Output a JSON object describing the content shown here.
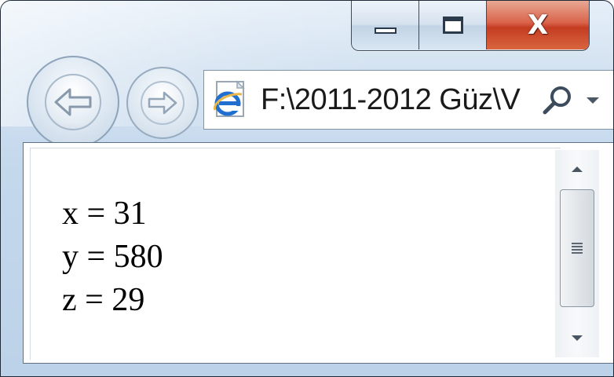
{
  "window": {
    "caption": {
      "minimize_icon": "minimize-icon",
      "maximize_icon": "maximize-icon",
      "close_glyph": "X"
    }
  },
  "navigation": {
    "back_icon": "back-arrow-icon",
    "forward_icon": "forward-arrow-icon"
  },
  "address_bar": {
    "url": "F:\\2011-2012 Güz\\V",
    "browser_icon": "internet-explorer-icon",
    "search_icon": "search-icon",
    "dropdown_icon": "chevron-down-icon"
  },
  "content": {
    "lines": [
      "x = 31",
      "y = 580",
      "z = 29"
    ]
  },
  "scrollbar": {
    "up_icon": "scroll-up-arrow-icon",
    "down_icon": "scroll-down-arrow-icon",
    "thumb_icon": "grip-icon"
  },
  "colors": {
    "close_button": "#d9634a",
    "frame": "#c4d8ec",
    "ie_blue": "#1e6fd0",
    "ie_gold": "#e8b84a"
  }
}
